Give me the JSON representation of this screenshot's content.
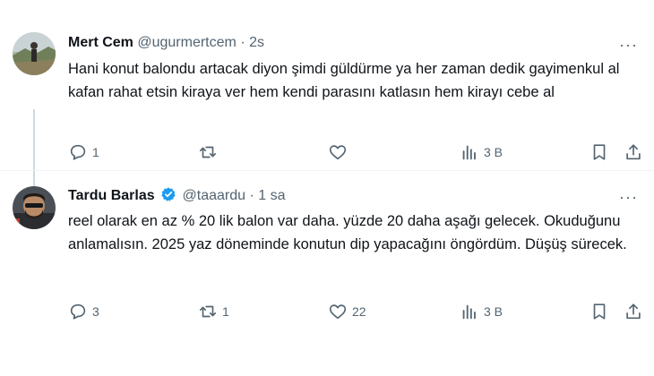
{
  "tweets": [
    {
      "name": "Mert Cem",
      "handle": "@ugurmertcem",
      "separator": "·",
      "time": "2s",
      "text": "Hani konut balondu artacak diyon şimdi güldürme ya her zaman dedik gayimenkul al kafan rahat etsin kiraya ver hem kendi parasını katlasın hem kirayı cebe al",
      "reply_count": "1",
      "retweet_count": "",
      "like_count": "",
      "views": "3 B",
      "verified": false
    },
    {
      "name": "Tardu Barlas",
      "handle": "@taaardu",
      "separator": "·",
      "time": "1 sa",
      "text": "reel olarak en az % 20 lik balon var daha. yüzde 20 daha aşağı gelecek. Okuduğunu anlamalısın. 2025 yaz döneminde konutun dip yapacağını öngördüm. Düşüş sürecek.",
      "reply_count": "3",
      "retweet_count": "1",
      "like_count": "22",
      "views": "3 B",
      "verified": true
    }
  ],
  "more_symbol": "···",
  "colors": {
    "text": "#0f1419",
    "muted": "#536471",
    "verified": "#1d9bf0",
    "line": "#cfd9de"
  }
}
